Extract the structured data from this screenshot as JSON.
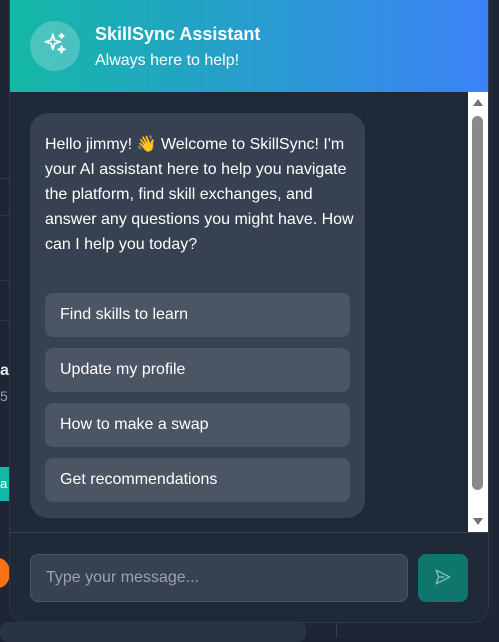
{
  "background": {
    "cut_title": "a",
    "cut_subtitle": "5",
    "cut_badge": "a"
  },
  "header": {
    "title": "SkillSync Assistant",
    "subtitle": "Always here to help!",
    "icon": "sparkles-icon"
  },
  "message": {
    "greeting": "Hello jimmy!",
    "emoji": "👋",
    "body": "Welcome to SkillSync! I'm your AI assistant here to help you navigate the platform, find skill exchanges, and answer any questions you might have. How can I help you today?",
    "quick_replies": [
      {
        "label": "Find skills to learn"
      },
      {
        "label": "Update my profile"
      },
      {
        "label": "How to make a swap"
      },
      {
        "label": "Get recommendations"
      }
    ]
  },
  "composer": {
    "placeholder": "Type your message...",
    "value": "",
    "send_icon": "send-icon"
  },
  "colors": {
    "gradient_start": "#14b8a6",
    "gradient_end": "#3b82f6",
    "bubble": "#374151",
    "quick_reply": "#4b5563",
    "send_button": "#0f766e"
  }
}
